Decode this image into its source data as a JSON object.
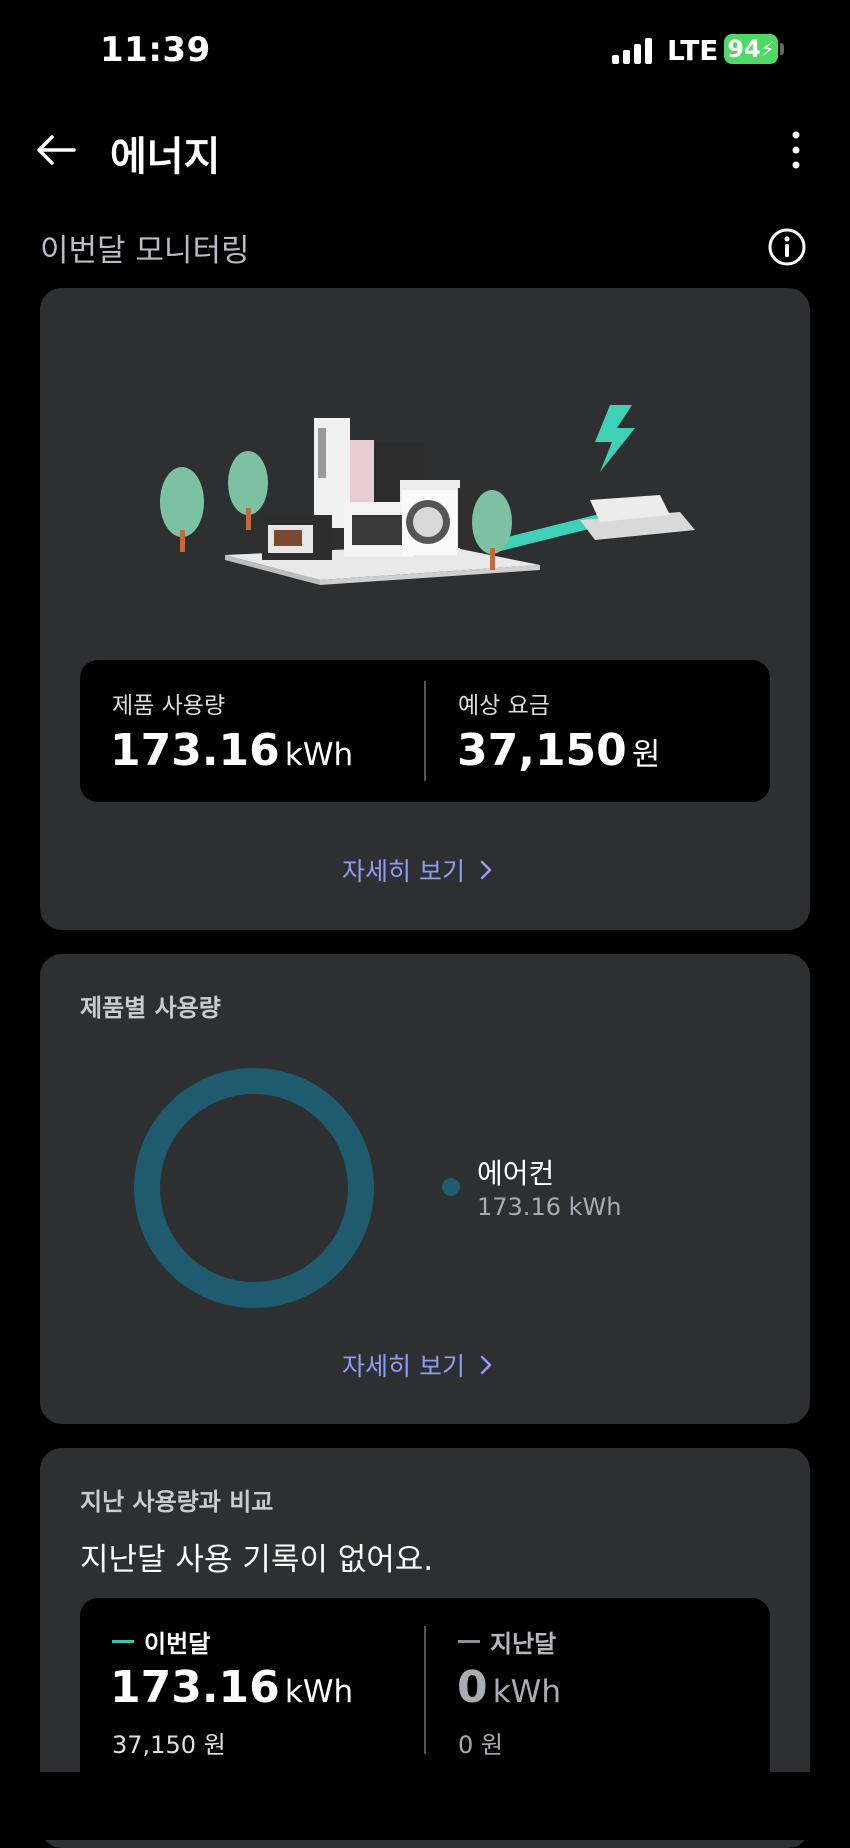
{
  "status_bar": {
    "time": "11:39",
    "network": "LTE",
    "battery": "94"
  },
  "header": {
    "title": "에너지"
  },
  "monitor": {
    "section_title": "이번달 모니터링",
    "usage_label": "제품 사용량",
    "usage_value": "173.16",
    "usage_unit": "kWh",
    "cost_label": "예상 요금",
    "cost_value": "37,150",
    "cost_unit": "원",
    "detail_link": "자세히 보기"
  },
  "by_product": {
    "title": "제품별 사용량",
    "items": [
      {
        "name": "에어컨",
        "value": "173.16 kWh",
        "color": "#1e5b6e"
      }
    ],
    "detail_link": "자세히 보기"
  },
  "compare": {
    "title": "지난 사용량과 비교",
    "message": "지난달 사용 기록이 없어요.",
    "this_month": {
      "label": "이번달",
      "value": "173.16",
      "unit": "kWh",
      "cost": "37,150 원",
      "color": "#3dc3b0"
    },
    "last_month": {
      "label": "지난달",
      "value": "0",
      "unit": "kWh",
      "cost": "0 원",
      "color": "#8a8d92"
    }
  },
  "colors": {
    "accent_link": "#8e9cf7",
    "card_bg": "#2d2f31",
    "ring": "#1e5b6e"
  }
}
